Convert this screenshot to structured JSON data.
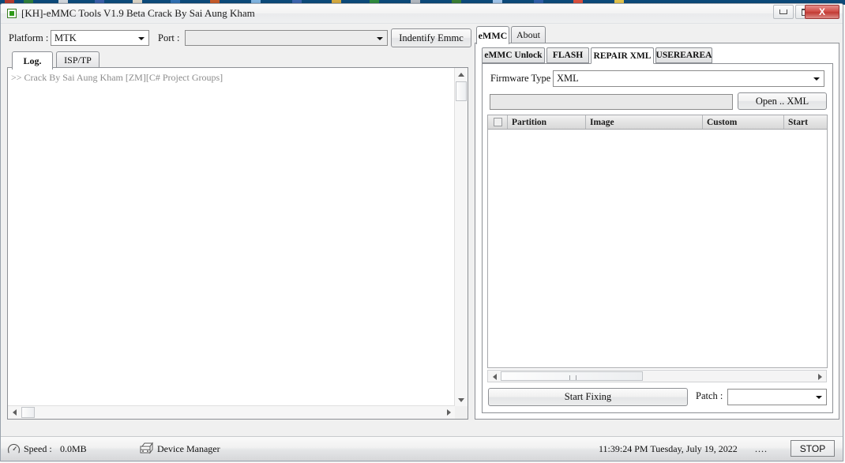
{
  "window": {
    "title": "[KH]-eMMC Tools V1.9 Beta Crack By Sai Aung Kham",
    "app_icon": "green-square-icon",
    "minimize_label": "",
    "maximize_label": "",
    "close_label": "X"
  },
  "toolbar": {
    "platform_label": "Platform :",
    "platform_value": "MTK",
    "port_label": "Port :",
    "port_value": "",
    "identify_button": "Indentify Emmc"
  },
  "left_panel": {
    "tabs": [
      {
        "label": "Log.",
        "selected": true
      },
      {
        "label": "ISP/TP",
        "selected": false
      }
    ],
    "log_lines": [
      ">> Crack By Sai Aung Kham [ZM][C# Project Groups]"
    ]
  },
  "right_panel": {
    "tabs": [
      {
        "label": "eMMC",
        "selected": true
      },
      {
        "label": "About",
        "selected": false
      }
    ],
    "sub_tabs": [
      {
        "label": "eMMC Unlock",
        "selected": false
      },
      {
        "label": "FLASH",
        "selected": false
      },
      {
        "label": "REPAIR XML",
        "selected": true
      },
      {
        "label": "USEREAREA",
        "selected": false
      }
    ],
    "repair_xml": {
      "firmware_type_label": "Firmware Type :",
      "firmware_type_value": "XML",
      "path_value": "",
      "open_xml_button": "Open .. XML",
      "table": {
        "columns": [
          "",
          "Partition",
          "Image",
          "Custom",
          "Start"
        ],
        "rows": []
      },
      "start_fixing_button": "Start Fixing",
      "patch_label": "Patch :",
      "patch_value": ""
    }
  },
  "status_bar": {
    "speed_icon": "gauge-icon",
    "speed_label": "Speed :",
    "speed_value": "0.0MB",
    "device_manager_icon": "device-manager-icon",
    "device_manager_label": "Device Manager",
    "timestamp": "11:39:24 PM Tuesday, July 19, 2022",
    "dots": "....",
    "stop_button": "STOP"
  },
  "colors": {
    "close_red": "#c23a33",
    "title_icon_green": "#2e9a18",
    "log_text_gray": "#8b8b8b",
    "window_chrome": "#f0f0f0"
  }
}
